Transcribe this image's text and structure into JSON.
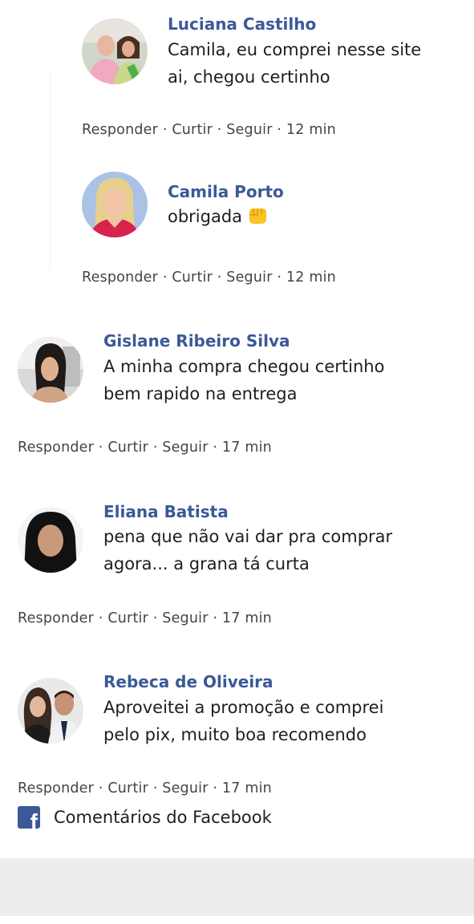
{
  "comments": [
    {
      "author": "Luciana Castilho",
      "lines": [
        "Camila, eu comprei nesse site",
        "ai, chegou certinho"
      ],
      "actions": {
        "reply": "Responder",
        "like": "Curtir",
        "follow": "Seguir",
        "time": "12 min"
      },
      "sep": "·"
    },
    {
      "author": "Camila Porto",
      "lines": [
        "obrigada"
      ],
      "emoji_icon": "fist-bump-icon",
      "actions": {
        "reply": "Responder",
        "like": "Curtir",
        "follow": "Seguir",
        "time": "12 min"
      },
      "sep": "·"
    },
    {
      "author": "Gislane Ribeiro Silva",
      "lines": [
        "A minha compra chegou certinho",
        "bem rapido na entrega"
      ],
      "actions": {
        "reply": "Responder",
        "like": "Curtir",
        "follow": "Seguir",
        "time": "17 min"
      },
      "sep": "·"
    },
    {
      "author": "Eliana Batista",
      "lines": [
        "pena que não vai dar pra comprar",
        "agora... a grana tá curta"
      ],
      "actions": {
        "reply": "Responder",
        "like": "Curtir",
        "follow": "Seguir",
        "time": "17 min"
      },
      "sep": "·"
    },
    {
      "author": "Rebeca de Oliveira",
      "lines": [
        "Aproveitei a promoção e comprei",
        "pelo pix, muito boa recomendo"
      ],
      "actions": {
        "reply": "Responder",
        "like": "Curtir",
        "follow": "Seguir",
        "time": "17 min"
      },
      "sep": "·"
    }
  ],
  "footer": {
    "icon": "facebook-logo-icon",
    "label": "Comentários do Facebook"
  },
  "colors": {
    "author_name": "#3b5998",
    "facebook_blue": "#3b5998",
    "bottom_band": "#ededed"
  }
}
